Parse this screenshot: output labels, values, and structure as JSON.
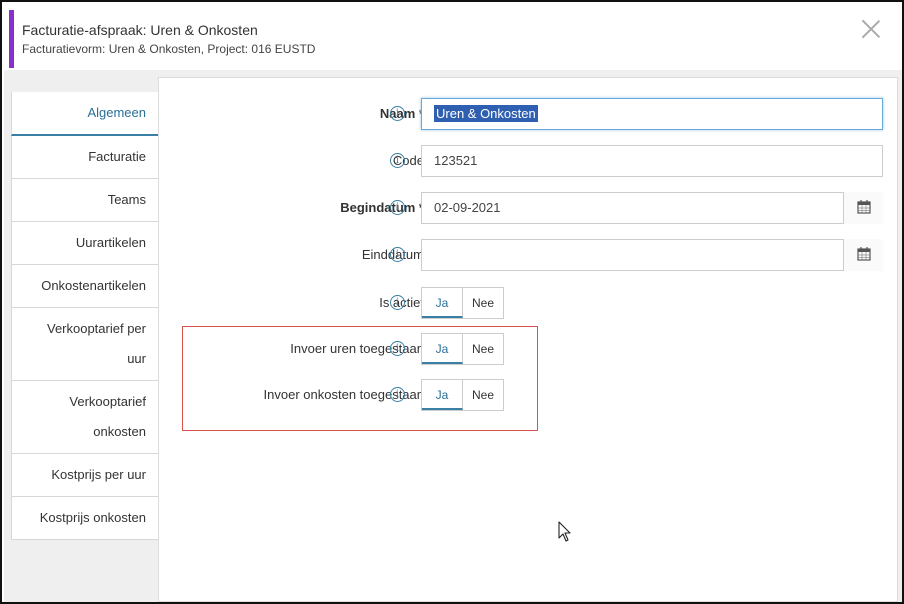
{
  "header": {
    "title": "Facturatie-afspraak: Uren & Onkosten",
    "subtitle": "Facturatievorm: Uren & Onkosten, Project: 016 EUSTD",
    "accent_color": "#8a2fc9"
  },
  "sidebar": {
    "items": [
      {
        "label": "Algemeen",
        "active": true
      },
      {
        "label": "Facturatie"
      },
      {
        "label": "Teams"
      },
      {
        "label": "Uurartikelen"
      },
      {
        "label": "Onkostenartikelen"
      },
      {
        "label": "Verkooptarief per uur"
      },
      {
        "label": "Verkooptarief onkosten"
      },
      {
        "label": "Kostprijs per uur"
      },
      {
        "label": "Kostprijs onkosten"
      }
    ]
  },
  "form": {
    "info_glyph": "i",
    "naam": {
      "label": "Naam *",
      "value": "Uren & Onkosten"
    },
    "code": {
      "label": "Code",
      "value": "123521"
    },
    "begindatum": {
      "label": "Begindatum *",
      "value": "02-09-2021"
    },
    "einddatum": {
      "label": "Einddatum",
      "value": ""
    },
    "is_actief": {
      "label": "Is actief",
      "yes": "Ja",
      "no": "Nee",
      "selected": "Ja"
    },
    "invoer_uren": {
      "label": "Invoer uren toegestaan",
      "yes": "Ja",
      "no": "Nee",
      "selected": "Ja"
    },
    "invoer_onkosten": {
      "label": "Invoer onkosten toegestaan",
      "yes": "Ja",
      "no": "Nee",
      "selected": "Ja"
    }
  },
  "colors": {
    "highlight_box": "#d9534f",
    "active_blue": "#3a7fa5"
  }
}
